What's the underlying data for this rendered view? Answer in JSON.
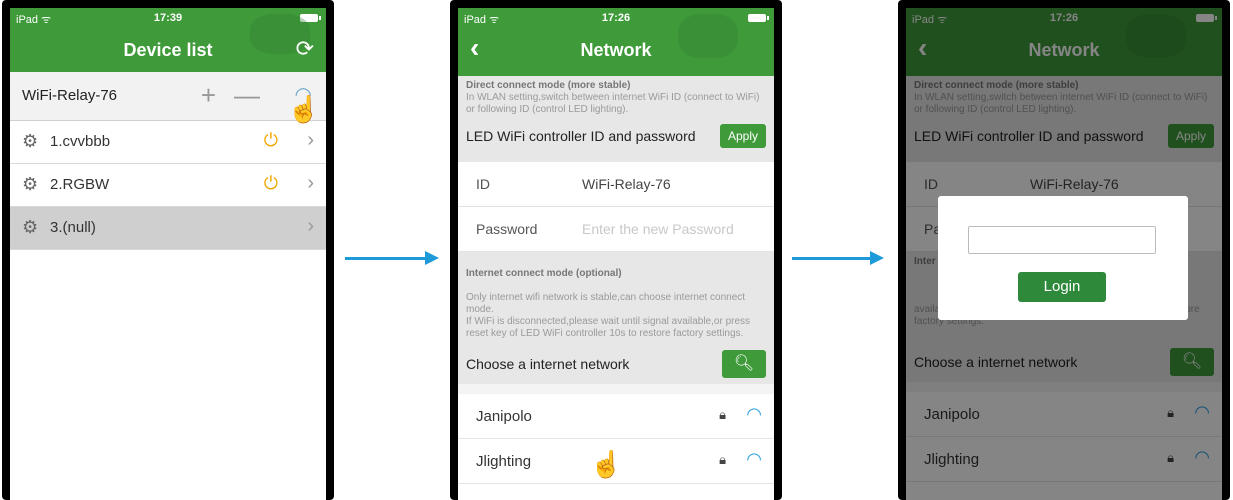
{
  "screen1": {
    "status": {
      "carrier": "iPad ᯤ",
      "time": "17:39"
    },
    "title": "Device list",
    "header": {
      "name": "WiFi-Relay-76"
    },
    "devices": [
      {
        "label": "1.cvvbbb"
      },
      {
        "label": "2.RGBW"
      },
      {
        "label": "3.(null)"
      }
    ]
  },
  "screen2": {
    "status": {
      "carrier": "iPad ᯤ",
      "time": "17:26"
    },
    "title": "Network",
    "direct_title": "Direct connect mode (more stable)",
    "direct_desc": "In WLAN setting,switch between internet WiFi ID (connect to WiFi) or following ID (control LED lighting).",
    "controller_label": "LED WiFi controller ID and password",
    "apply_label": "Apply",
    "id_label": "ID",
    "id_value": "WiFi-Relay-76",
    "password_label": "Password",
    "password_placeholder": "Enter the new Password",
    "internet_title": "Internet connect mode (optional)",
    "internet_desc": "Only internet wifi network is stable,can choose internet connect mode.\nIf WiFi is disconnected,please wait until signal available,or press reset key of LED WiFi controller 10s to restore factory settings.",
    "choose_label": "Choose a internet network",
    "networks": [
      {
        "name": "Janipolo"
      },
      {
        "name": "Jlighting"
      }
    ]
  },
  "screen3": {
    "status": {
      "carrier": "iPad ᯤ",
      "time": "17:26"
    },
    "title": "Network",
    "direct_title": "Direct connect mode (more stable)",
    "direct_desc": "In WLAN setting,switch between internet WiFi ID (connect to WiFi) or following ID (control LED lighting).",
    "controller_label": "LED WiFi controller ID and password",
    "apply_label": "Apply",
    "id_label": "ID",
    "id_value": "WiFi-Relay-76",
    "password_label_partial": "Pa",
    "internet_title_partial": "Inter",
    "internet_desc_tail": "available,or press reset key of LED WiFi controller 10s to restore factory settings.",
    "choose_label": "Choose a internet network",
    "networks": [
      {
        "name": "Janipolo"
      },
      {
        "name": "Jlighting"
      }
    ],
    "dialog": {
      "login_label": "Login"
    }
  },
  "colors": {
    "primary": "#3f9a3a",
    "accent_arrow": "#1e9ad8",
    "wifi": "#2aa0dd",
    "power": "#f0a800"
  },
  "icons": [
    "refresh-icon",
    "back-icon",
    "gear-icon",
    "power-icon",
    "chevron-right-icon",
    "plus-icon",
    "minus-icon",
    "wifi-icon",
    "lock-icon",
    "search-icon",
    "hand-pointer-icon",
    "arrow-right-icon"
  ]
}
